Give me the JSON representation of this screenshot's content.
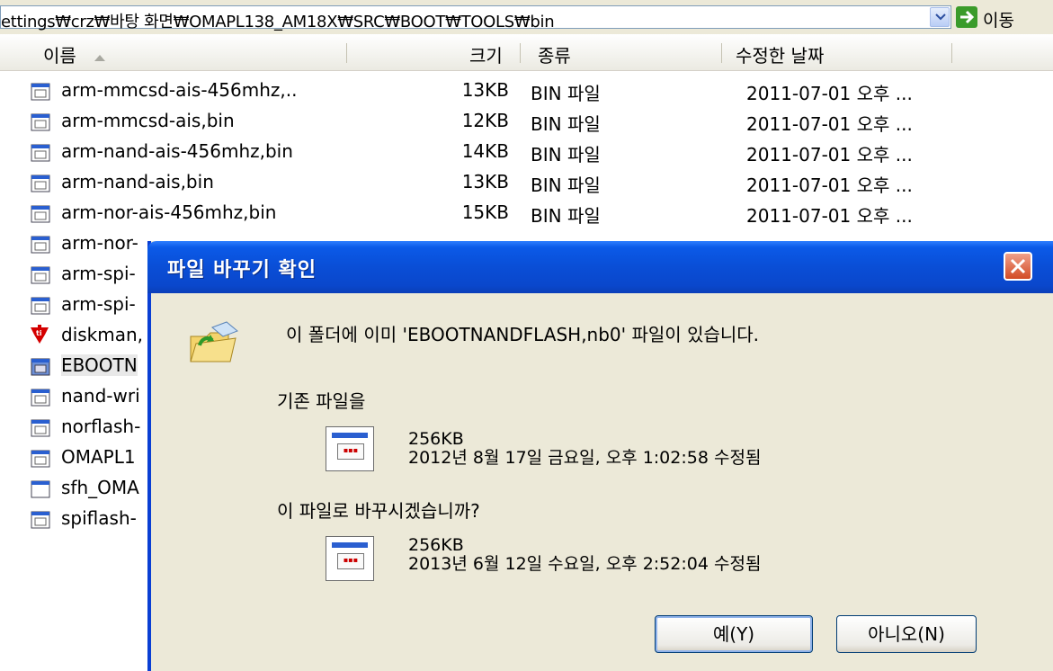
{
  "address": {
    "path": "ettings₩crz₩바탕 화면₩OMAPL138_AM18X₩SRC₩BOOT₩TOOLS₩bin",
    "go_label": "이동"
  },
  "columns": {
    "name": "이름",
    "size": "크기",
    "type": "종류",
    "modified": "수정한 날짜"
  },
  "files": [
    {
      "name": "arm-mmcsd-ais-456mhz,..",
      "size": "13KB",
      "type": "BIN 파일",
      "modified": "2011-07-01 오후 ..."
    },
    {
      "name": "arm-mmcsd-ais,bin",
      "size": "12KB",
      "type": "BIN 파일",
      "modified": "2011-07-01 오후 ..."
    },
    {
      "name": "arm-nand-ais-456mhz,bin",
      "size": "14KB",
      "type": "BIN 파일",
      "modified": "2011-07-01 오후 ..."
    },
    {
      "name": "arm-nand-ais,bin",
      "size": "13KB",
      "type": "BIN 파일",
      "modified": "2011-07-01 오후 ..."
    },
    {
      "name": "arm-nor-ais-456mhz,bin",
      "size": "15KB",
      "type": "BIN 파일",
      "modified": "2011-07-01 오후 ..."
    },
    {
      "name": "arm-nor-",
      "size": "",
      "type": "",
      "modified": ""
    },
    {
      "name": "arm-spi-",
      "size": "",
      "type": "",
      "modified": ""
    },
    {
      "name": "arm-spi-",
      "size": "",
      "type": "",
      "modified": ""
    },
    {
      "name": "diskman,",
      "size": "",
      "type": "",
      "modified": ""
    },
    {
      "name": "EBOOTN",
      "size": "",
      "type": "",
      "modified": ""
    },
    {
      "name": "nand-wri",
      "size": "",
      "type": "",
      "modified": ""
    },
    {
      "name": "norflash-",
      "size": "",
      "type": "",
      "modified": ""
    },
    {
      "name": "OMAPL1",
      "size": "",
      "type": "",
      "modified": ""
    },
    {
      "name": "sfh_OMA",
      "size": "",
      "type": "",
      "modified": ""
    },
    {
      "name": "spiflash-",
      "size": "",
      "type": "",
      "modified": ""
    }
  ],
  "dialog": {
    "title": "파일 바꾸기 확인",
    "message": "이 폴더에 이미 'EBOOTNANDFLASH,nb0' 파일이 있습니다.",
    "existing_label": "기존 파일을",
    "existing_size": "256KB",
    "existing_date": "2012년 8월 17일 금요일, 오후 1:02:58 수정됨",
    "replace_label": "이 파일로 바꾸시겠습니까?",
    "new_size": "256KB",
    "new_date": "2013년 6월 12일 수요일, 오후 2:52:04 수정됨",
    "yes_label": "예(Y)",
    "no_label": "아니오(N)"
  },
  "colors": {
    "title_bar": "#0a4ed6",
    "dialog_bg": "#ece9d8",
    "close_btn": "#d24a24"
  }
}
